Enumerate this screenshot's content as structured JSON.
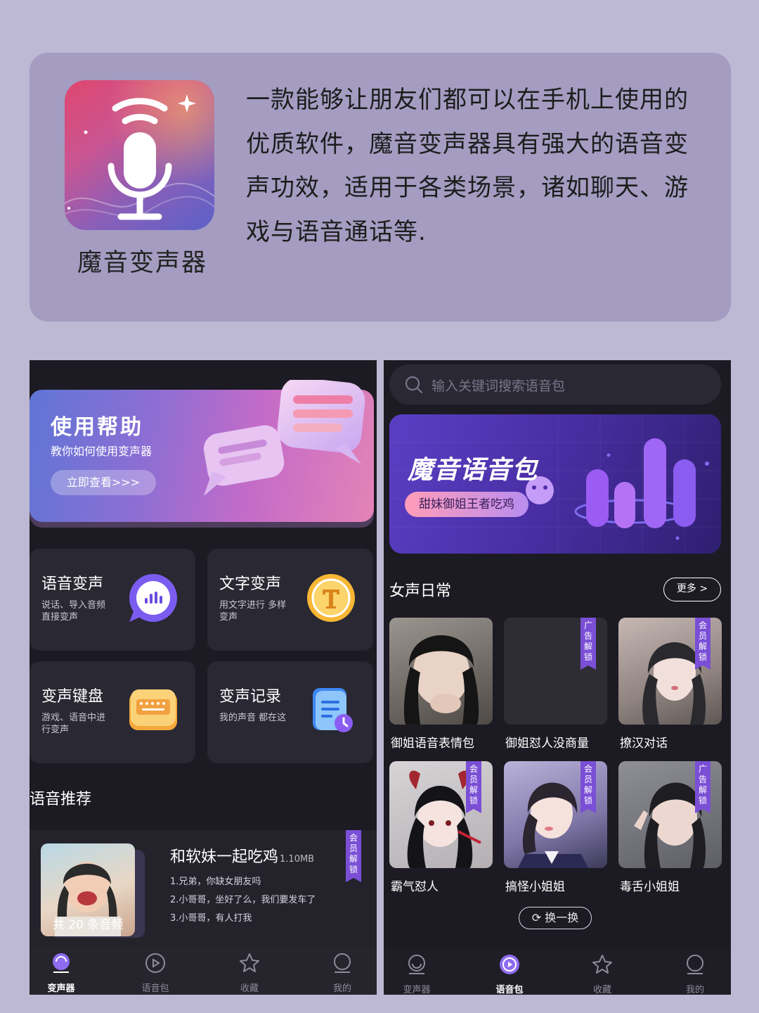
{
  "intro": {
    "app_name": "魔音变声器",
    "description": "一款能够让朋友们都可以在手机上使用的优质软件，魔音变声器具有强大的语音变声功效，适用于各类场景，诸如聊天、游戏与语音通话等."
  },
  "left_phone": {
    "help_banner": {
      "title": "使用帮助",
      "subtitle": "教你如何使用变声器",
      "button": "立即查看>>>"
    },
    "tiles": [
      {
        "title": "语音变声",
        "desc": "说话、导入音频 直接变声"
      },
      {
        "title": "文字变声",
        "desc": "用文字进行 多样变声"
      },
      {
        "title": "变声键盘",
        "desc": "游戏、语音中进行变声"
      },
      {
        "title": "变声记录",
        "desc": "我的声音 都在这"
      }
    ],
    "section_title": "语音推荐",
    "recommend": {
      "title": "和软妹一起吃鸡",
      "size": "1.10MB",
      "lines": [
        "1.兄弟，你缺女朋友吗",
        "2.小哥哥，坐好了么，我们要发车了",
        "3.小哥哥，有人打我"
      ],
      "count": "共 20 条音频",
      "tag": "会员解锁"
    },
    "nav": [
      {
        "label": "变声器",
        "icon": "voice-changer-icon",
        "active": true
      },
      {
        "label": "语音包",
        "icon": "play-icon",
        "active": false
      },
      {
        "label": "收藏",
        "icon": "star-icon",
        "active": false
      },
      {
        "label": "我的",
        "icon": "user-icon",
        "active": false
      }
    ]
  },
  "right_phone": {
    "search_placeholder": "输入关键词搜索语音包",
    "banner": {
      "title": "魔音语音包",
      "pill": "甜妹御姐王者吃鸡"
    },
    "section_title": "女声日常",
    "more": "更多 >",
    "items": [
      {
        "label": "御姐语音表情包",
        "tag": ""
      },
      {
        "label": "御姐怼人没商量",
        "tag": "广告解锁"
      },
      {
        "label": "撩汉对话",
        "tag": "会员解锁"
      },
      {
        "label": "霸气怼人",
        "tag": "会员解锁"
      },
      {
        "label": "搞怪小姐姐",
        "tag": "会员解锁"
      },
      {
        "label": "毒舌小姐姐",
        "tag": "广告解锁"
      }
    ],
    "swap": "换一换",
    "nav": [
      {
        "label": "变声器",
        "icon": "voice-changer-icon",
        "active": false
      },
      {
        "label": "语音包",
        "icon": "play-icon",
        "active": true
      },
      {
        "label": "收藏",
        "icon": "star-icon",
        "active": false
      },
      {
        "label": "我的",
        "icon": "user-icon",
        "active": false
      }
    ]
  }
}
